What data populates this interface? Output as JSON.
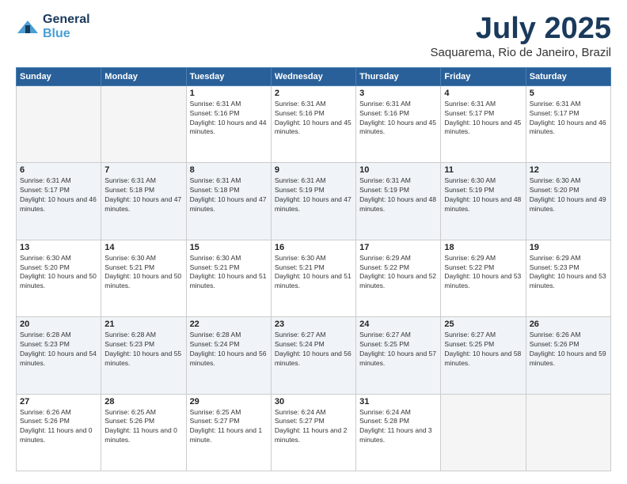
{
  "header": {
    "logo": {
      "line1": "General",
      "line2": "Blue"
    },
    "title": "July 2025",
    "location": "Saquarema, Rio de Janeiro, Brazil"
  },
  "weekdays": [
    "Sunday",
    "Monday",
    "Tuesday",
    "Wednesday",
    "Thursday",
    "Friday",
    "Saturday"
  ],
  "weeks": [
    [
      {
        "day": "",
        "empty": true
      },
      {
        "day": "",
        "empty": true
      },
      {
        "day": "1",
        "sunrise": "6:31 AM",
        "sunset": "5:16 PM",
        "daylight": "10 hours and 44 minutes."
      },
      {
        "day": "2",
        "sunrise": "6:31 AM",
        "sunset": "5:16 PM",
        "daylight": "10 hours and 45 minutes."
      },
      {
        "day": "3",
        "sunrise": "6:31 AM",
        "sunset": "5:16 PM",
        "daylight": "10 hours and 45 minutes."
      },
      {
        "day": "4",
        "sunrise": "6:31 AM",
        "sunset": "5:17 PM",
        "daylight": "10 hours and 45 minutes."
      },
      {
        "day": "5",
        "sunrise": "6:31 AM",
        "sunset": "5:17 PM",
        "daylight": "10 hours and 46 minutes."
      }
    ],
    [
      {
        "day": "6",
        "sunrise": "6:31 AM",
        "sunset": "5:17 PM",
        "daylight": "10 hours and 46 minutes."
      },
      {
        "day": "7",
        "sunrise": "6:31 AM",
        "sunset": "5:18 PM",
        "daylight": "10 hours and 47 minutes."
      },
      {
        "day": "8",
        "sunrise": "6:31 AM",
        "sunset": "5:18 PM",
        "daylight": "10 hours and 47 minutes."
      },
      {
        "day": "9",
        "sunrise": "6:31 AM",
        "sunset": "5:19 PM",
        "daylight": "10 hours and 47 minutes."
      },
      {
        "day": "10",
        "sunrise": "6:31 AM",
        "sunset": "5:19 PM",
        "daylight": "10 hours and 48 minutes."
      },
      {
        "day": "11",
        "sunrise": "6:30 AM",
        "sunset": "5:19 PM",
        "daylight": "10 hours and 48 minutes."
      },
      {
        "day": "12",
        "sunrise": "6:30 AM",
        "sunset": "5:20 PM",
        "daylight": "10 hours and 49 minutes."
      }
    ],
    [
      {
        "day": "13",
        "sunrise": "6:30 AM",
        "sunset": "5:20 PM",
        "daylight": "10 hours and 50 minutes."
      },
      {
        "day": "14",
        "sunrise": "6:30 AM",
        "sunset": "5:21 PM",
        "daylight": "10 hours and 50 minutes."
      },
      {
        "day": "15",
        "sunrise": "6:30 AM",
        "sunset": "5:21 PM",
        "daylight": "10 hours and 51 minutes."
      },
      {
        "day": "16",
        "sunrise": "6:30 AM",
        "sunset": "5:21 PM",
        "daylight": "10 hours and 51 minutes."
      },
      {
        "day": "17",
        "sunrise": "6:29 AM",
        "sunset": "5:22 PM",
        "daylight": "10 hours and 52 minutes."
      },
      {
        "day": "18",
        "sunrise": "6:29 AM",
        "sunset": "5:22 PM",
        "daylight": "10 hours and 53 minutes."
      },
      {
        "day": "19",
        "sunrise": "6:29 AM",
        "sunset": "5:23 PM",
        "daylight": "10 hours and 53 minutes."
      }
    ],
    [
      {
        "day": "20",
        "sunrise": "6:28 AM",
        "sunset": "5:23 PM",
        "daylight": "10 hours and 54 minutes."
      },
      {
        "day": "21",
        "sunrise": "6:28 AM",
        "sunset": "5:23 PM",
        "daylight": "10 hours and 55 minutes."
      },
      {
        "day": "22",
        "sunrise": "6:28 AM",
        "sunset": "5:24 PM",
        "daylight": "10 hours and 56 minutes."
      },
      {
        "day": "23",
        "sunrise": "6:27 AM",
        "sunset": "5:24 PM",
        "daylight": "10 hours and 56 minutes."
      },
      {
        "day": "24",
        "sunrise": "6:27 AM",
        "sunset": "5:25 PM",
        "daylight": "10 hours and 57 minutes."
      },
      {
        "day": "25",
        "sunrise": "6:27 AM",
        "sunset": "5:25 PM",
        "daylight": "10 hours and 58 minutes."
      },
      {
        "day": "26",
        "sunrise": "6:26 AM",
        "sunset": "5:26 PM",
        "daylight": "10 hours and 59 minutes."
      }
    ],
    [
      {
        "day": "27",
        "sunrise": "6:26 AM",
        "sunset": "5:26 PM",
        "daylight": "11 hours and 0 minutes."
      },
      {
        "day": "28",
        "sunrise": "6:25 AM",
        "sunset": "5:26 PM",
        "daylight": "11 hours and 0 minutes."
      },
      {
        "day": "29",
        "sunrise": "6:25 AM",
        "sunset": "5:27 PM",
        "daylight": "11 hours and 1 minute."
      },
      {
        "day": "30",
        "sunrise": "6:24 AM",
        "sunset": "5:27 PM",
        "daylight": "11 hours and 2 minutes."
      },
      {
        "day": "31",
        "sunrise": "6:24 AM",
        "sunset": "5:28 PM",
        "daylight": "11 hours and 3 minutes."
      },
      {
        "day": "",
        "empty": true
      },
      {
        "day": "",
        "empty": true
      }
    ]
  ]
}
